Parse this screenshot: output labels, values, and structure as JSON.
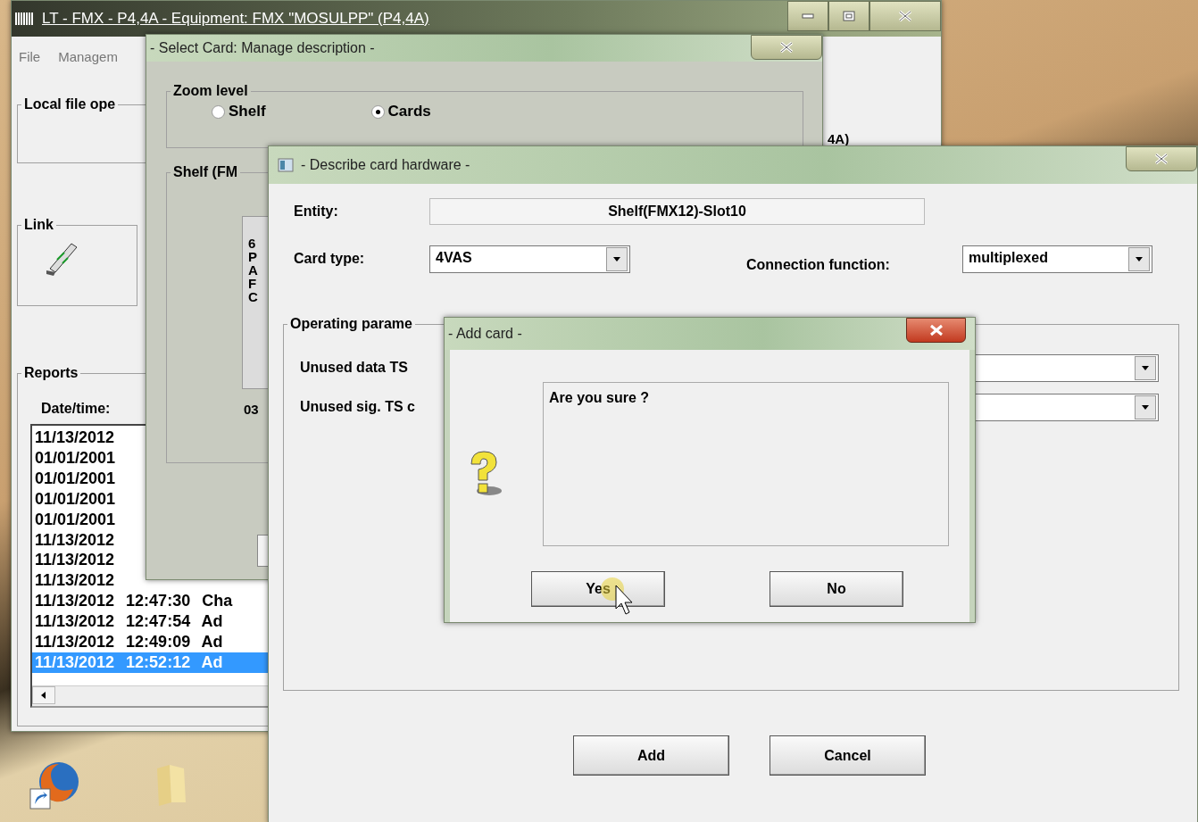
{
  "main_window": {
    "title": "LT - FMX - P4,4A - Equipment: FMX \"MOSULPP\" (P4,4A)",
    "menu": [
      "File",
      "Managem"
    ],
    "local_file_group": "Local file ope",
    "link_group": "Link",
    "partial_label": "4A)",
    "reports": {
      "label": "Reports",
      "date_label": "Date/time:",
      "rows": [
        {
          "text": "11/13/2012",
          "selected": false
        },
        {
          "text": "01/01/2001",
          "selected": false
        },
        {
          "text": "01/01/2001",
          "selected": false
        },
        {
          "text": "01/01/2001",
          "selected": false
        },
        {
          "text": "01/01/2001",
          "selected": false
        },
        {
          "text": "11/13/2012",
          "selected": false
        },
        {
          "text": "11/13/2012",
          "selected": false
        },
        {
          "text": "11/13/2012",
          "selected": false
        },
        {
          "text": "11/13/2012 12:47:30 Cha",
          "selected": false
        },
        {
          "text": "11/13/2012 12:47:54 Ad",
          "selected": false
        },
        {
          "text": "11/13/2012 12:49:09 Ad",
          "selected": false
        },
        {
          "text": "11/13/2012 12:52:12 Ad",
          "selected": true
        }
      ]
    }
  },
  "select_card": {
    "title": "- Select Card: Manage description -",
    "zoom_level": {
      "label": "Zoom level",
      "options": [
        {
          "label": "Shelf",
          "selected": false
        },
        {
          "label": "Cards",
          "selected": true
        }
      ]
    },
    "shelf": {
      "label": "Shelf (FM",
      "card_label": "6PAFC",
      "slot": "03"
    }
  },
  "describe": {
    "title": "- Describe card hardware -",
    "entity_label": "Entity:",
    "entity": "Shelf(FMX12)-Slot10",
    "card_type_label": "Card type:",
    "card_type": "4VAS",
    "connection_label": "Connection function:",
    "connection": "multiplexed",
    "params": {
      "label": "Operating parame",
      "rows": [
        "Unused data TS",
        "Unused sig. TS c"
      ]
    },
    "buttons": [
      "Add",
      "Cancel"
    ]
  },
  "dialog": {
    "title": "- Add card -",
    "message": "Are you sure ?",
    "buttons": [
      "Yes",
      "No"
    ]
  }
}
